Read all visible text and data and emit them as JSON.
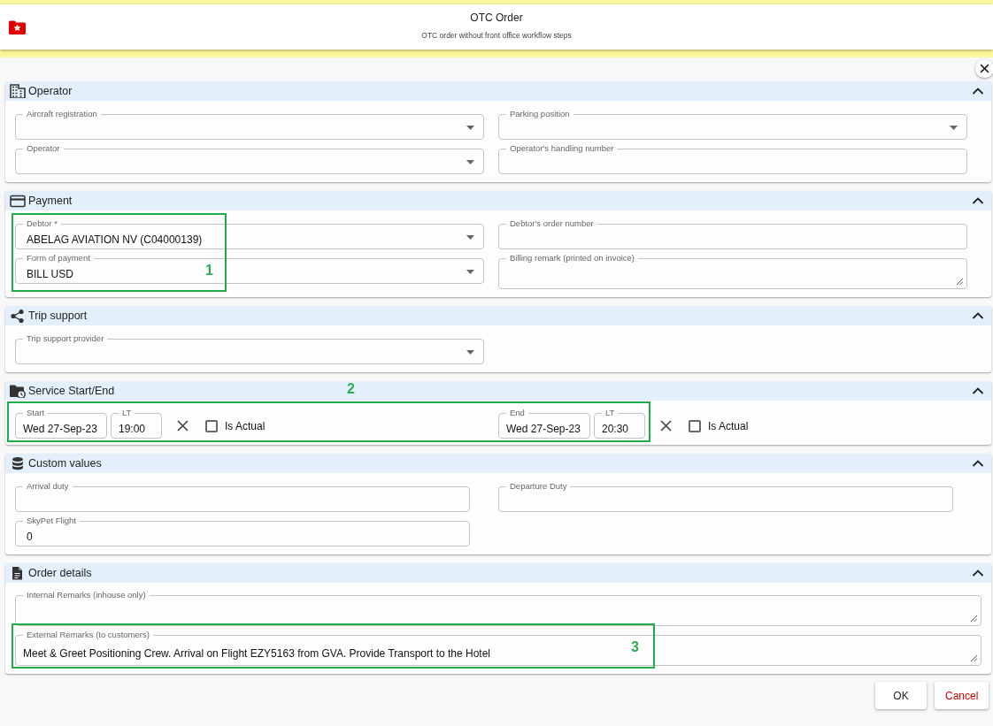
{
  "header": {
    "title": "OTC Order",
    "subtitle": "OTC order without front office workflow steps"
  },
  "sections": [
    {
      "kind": "fields",
      "title": "Operator",
      "expanded": true,
      "fields": [
        {
          "label": "Aircraft registration",
          "kind": "select"
        },
        {
          "label": "Parking position",
          "kind": "select"
        },
        {
          "label": "Operator",
          "kind": "select"
        },
        {
          "label": "Operator's handling number",
          "kind": "text"
        }
      ]
    },
    {
      "kind": "fields",
      "title": "Payment",
      "expanded": true,
      "annotation": {
        "label": "1"
      },
      "fields": [
        {
          "label": "Debtor *",
          "value": "ABELAG AVIATION NV (C04000139)",
          "kind": "select"
        },
        {
          "label": "Debtor's order number",
          "kind": "text"
        },
        {
          "label": "Form of payment",
          "value": "BILL USD",
          "kind": "select"
        },
        {
          "label": "Billing remark (printed on invoice)",
          "kind": "textarea"
        }
      ]
    },
    {
      "kind": "fields",
      "title": "Trip support",
      "expanded": true,
      "fields": [
        {
          "label": "Trip support provider",
          "kind": "select"
        }
      ]
    },
    {
      "kind": "datetime",
      "title": "Service Start/End",
      "expanded": true,
      "annotation": {
        "label": "2"
      },
      "ranges": [
        {
          "date_label": "Start",
          "date": "Wed 27-Sep-23",
          "time_label": "LT",
          "time": "19:00",
          "check_label": "Is Actual",
          "checked": false
        },
        {
          "date_label": "End",
          "date": "Wed 27-Sep-23",
          "time_label": "LT",
          "time": "20:30",
          "check_label": "Is Actual",
          "checked": false
        }
      ]
    },
    {
      "kind": "fields",
      "title": "Custom values",
      "expanded": true,
      "fields": [
        {
          "label": "Arrival duty",
          "kind": "text"
        },
        {
          "label": "Departure Duty",
          "kind": "text"
        },
        {
          "label": "SkyPet Flight",
          "value": "0",
          "kind": "text"
        }
      ]
    },
    {
      "kind": "remarks",
      "title": "Order details",
      "expanded": true,
      "annotation": {
        "label": "3"
      },
      "fields": [
        {
          "label": "Internal Remarks (inhouse only)",
          "kind": "textarea"
        },
        {
          "label": "External Remarks (to customers)",
          "value": "Meet & Greet Positioning Crew. Arrival on Flight EZY5163 from GVA. Provide Transport to the Hotel",
          "kind": "textarea"
        }
      ]
    }
  ],
  "buttons": [
    {
      "label": "OK",
      "kind": "primary"
    },
    {
      "label": "Cancel",
      "kind": "cancel"
    }
  ]
}
